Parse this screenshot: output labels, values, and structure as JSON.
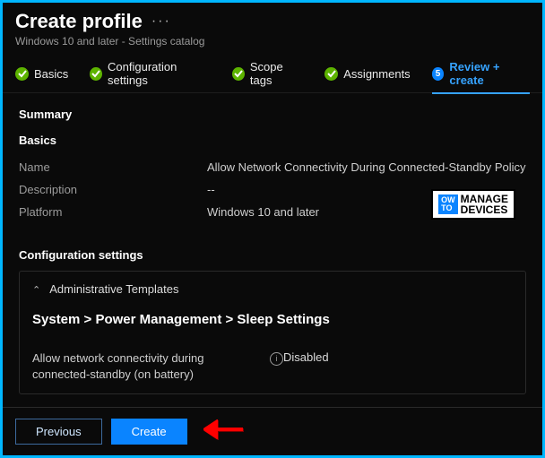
{
  "header": {
    "title": "Create profile",
    "more": "···",
    "subtitle": "Windows 10 and later - Settings catalog"
  },
  "steps": [
    {
      "label": "Basics"
    },
    {
      "label": "Configuration settings"
    },
    {
      "label": "Scope tags"
    },
    {
      "label": "Assignments"
    },
    {
      "label": "Review + create",
      "num": "5"
    }
  ],
  "summary": {
    "heading": "Summary",
    "basics_heading": "Basics",
    "rows": [
      {
        "k": "Name",
        "v": "Allow Network Connectivity During Connected-Standby Policy"
      },
      {
        "k": "Description",
        "v": "--"
      },
      {
        "k": "Platform",
        "v": "Windows 10 and later"
      }
    ]
  },
  "config": {
    "heading": "Configuration settings",
    "accordion": "Administrative Templates",
    "breadcrumb": "System  >  Power Management  >  Sleep Settings",
    "setting_label": "Allow network connectivity during connected-standby (on battery)",
    "setting_value": "Disabled"
  },
  "footer": {
    "previous": "Previous",
    "create": "Create"
  },
  "watermark": {
    "how": "OW",
    "to": "TO",
    "manage": "MANAGE",
    "devices": "DEVICES"
  }
}
